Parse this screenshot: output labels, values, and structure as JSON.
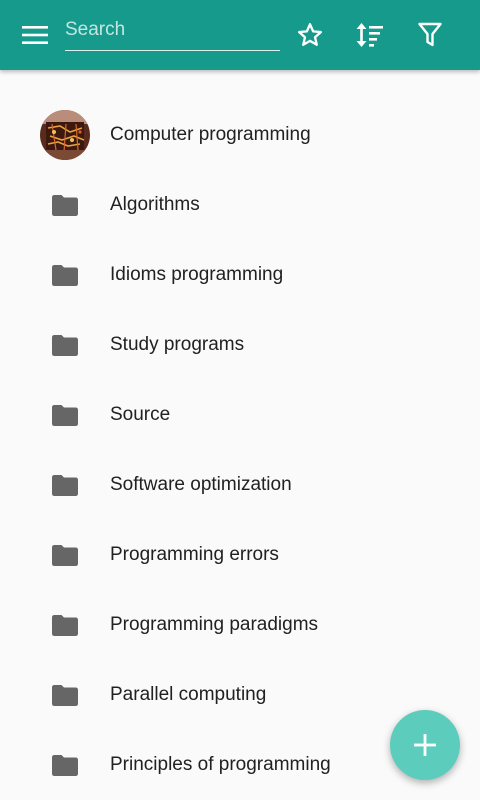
{
  "colors": {
    "toolbar": "#169a8b",
    "fab": "#5ccdbc",
    "folder_icon": "#666666",
    "text": "#212121",
    "background": "#fafafa"
  },
  "toolbar": {
    "menu_icon": "menu-icon",
    "search_placeholder": "Search",
    "search_value": "",
    "favorite_icon": "star-outline-icon",
    "sort_icon": "sort-icon",
    "filter_icon": "filter-icon"
  },
  "list": {
    "items": [
      {
        "label": "Computer programming",
        "icon": "category-avatar"
      },
      {
        "label": "Algorithms",
        "icon": "folder-icon"
      },
      {
        "label": "Idioms programming",
        "icon": "folder-icon"
      },
      {
        "label": "Study programs",
        "icon": "folder-icon"
      },
      {
        "label": "Source",
        "icon": "folder-icon"
      },
      {
        "label": "Software optimization",
        "icon": "folder-icon"
      },
      {
        "label": "Programming errors",
        "icon": "folder-icon"
      },
      {
        "label": "Programming paradigms",
        "icon": "folder-icon"
      },
      {
        "label": "Parallel computing",
        "icon": "folder-icon"
      },
      {
        "label": "Principles of programming",
        "icon": "folder-icon"
      }
    ]
  },
  "fab": {
    "icon": "plus-icon"
  }
}
